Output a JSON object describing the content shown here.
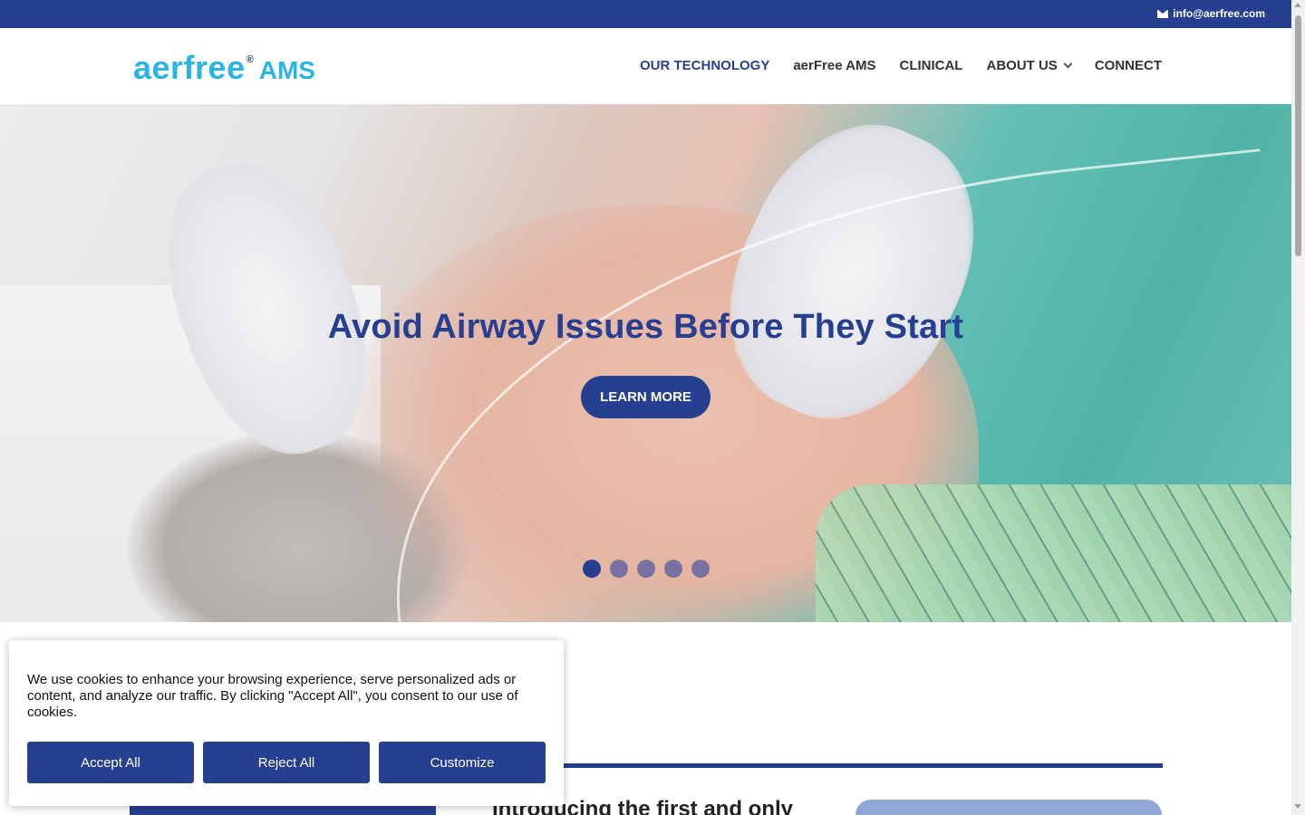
{
  "topbar": {
    "email": "info@aerfree.com",
    "email_icon": "envelope-icon"
  },
  "logo": {
    "part1": "aer",
    "part2": "free",
    "reg": "®",
    "suffix": "AMS"
  },
  "nav": {
    "items": [
      {
        "label": "OUR TECHNOLOGY",
        "active": true
      },
      {
        "label": "aerFree AMS"
      },
      {
        "label": "CLINICAL"
      },
      {
        "label": "ABOUT US",
        "has_dropdown": true
      },
      {
        "label": "CONNECT"
      }
    ]
  },
  "hero": {
    "title": "Avoid Airway Issues Before They Start",
    "cta": "LEARN MORE",
    "slides_total": 5,
    "active_slide": 1
  },
  "section": {
    "intro_text": "Introducing the first and only"
  },
  "cookie": {
    "message": "We use cookies to enhance your browsing experience, serve personalized ads or content, and analyze our traffic. By clicking \"Accept All\", you consent to our use of cookies.",
    "accept": "Accept All",
    "reject": "Reject All",
    "customize": "Customize"
  },
  "colors": {
    "brand_navy": "#263f91",
    "brand_cyan": "#2bb3e3"
  }
}
